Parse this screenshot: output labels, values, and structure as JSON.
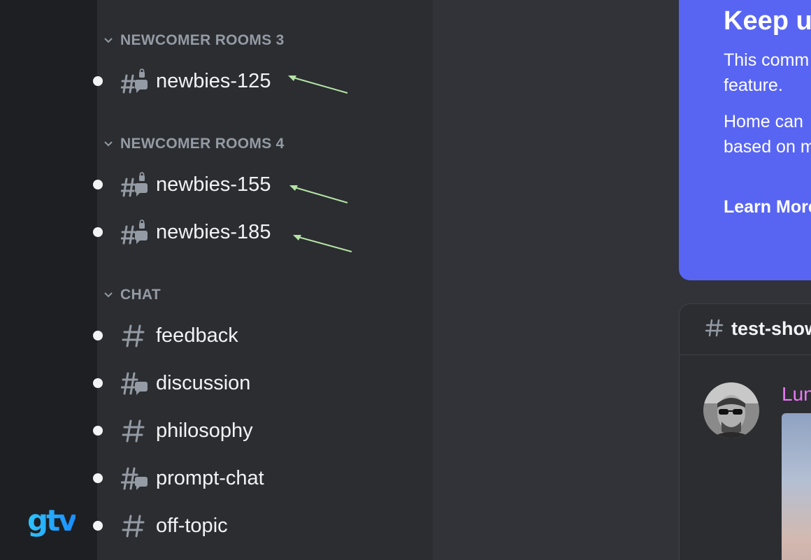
{
  "categories": {
    "newcomer_rooms_3": "NEWCOMER ROOMS 3",
    "newcomer_rooms_4": "NEWCOMER ROOMS 4",
    "chat": "CHAT"
  },
  "channels": [
    {
      "name": "newbies-125",
      "icon": "forum-locked-icon",
      "unread": true,
      "annotated": true
    },
    {
      "name": "newbies-155",
      "icon": "forum-locked-icon",
      "unread": true,
      "annotated": true
    },
    {
      "name": "newbies-185",
      "icon": "forum-locked-icon",
      "unread": true,
      "annotated": true
    },
    {
      "name": "feedback",
      "icon": "hash-icon",
      "unread": true
    },
    {
      "name": "discussion",
      "icon": "forum-icon",
      "unread": true
    },
    {
      "name": "philosophy",
      "icon": "hash-icon",
      "unread": true
    },
    {
      "name": "prompt-chat",
      "icon": "forum-icon",
      "unread": true
    },
    {
      "name": "off-topic",
      "icon": "hash-icon",
      "unread": true
    }
  ],
  "promo": {
    "title": "Keep u",
    "line1": "This comm",
    "line2": "feature.",
    "line3": "Home can",
    "line4": "based on m",
    "learn_more": "Learn More"
  },
  "post_card": {
    "channel": "test-show",
    "author": "Lun"
  },
  "branding": {
    "logo_text": "gtv"
  },
  "colors": {
    "rail": "#1e1f22",
    "sidebar": "#2b2d31",
    "main": "#313338",
    "promo": "#5865f2",
    "author": "#e979f5",
    "annotation_arrow": "#b5e3a4"
  }
}
